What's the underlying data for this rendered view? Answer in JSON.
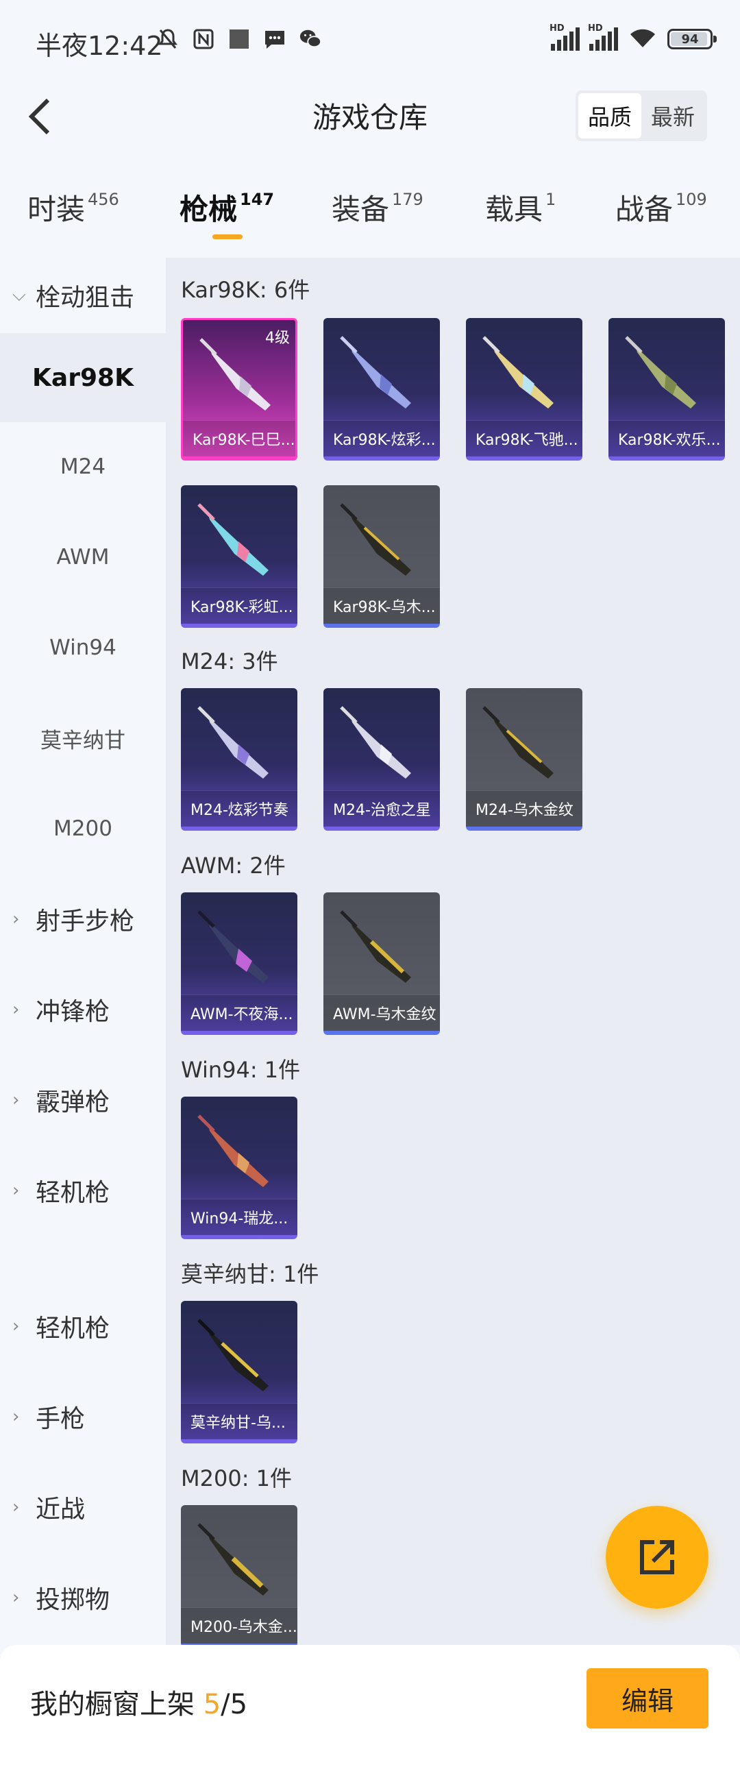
{
  "status_bar": {
    "time": "半夜12:42",
    "battery": "94",
    "hd1": "HD",
    "hd2": "HD"
  },
  "header": {
    "title": "游戏仓库",
    "sort_options": [
      "品质",
      "最新"
    ]
  },
  "tabs": [
    {
      "label": "时装",
      "count": "456"
    },
    {
      "label": "枪械",
      "count": "147"
    },
    {
      "label": "装备",
      "count": "179"
    },
    {
      "label": "载具",
      "count": "1"
    },
    {
      "label": "战备",
      "count": "109"
    }
  ],
  "sidebar": {
    "categories": [
      {
        "label": "栓动狙击",
        "arrow": "⌵"
      },
      {
        "label": "射手步枪",
        "arrow": "›"
      },
      {
        "label": "冲锋枪",
        "arrow": "›"
      },
      {
        "label": "霰弹枪",
        "arrow": "›"
      },
      {
        "label": "轻机枪",
        "arrow": "›"
      },
      {
        "label": "轻机枪",
        "arrow": "›"
      },
      {
        "label": "手枪",
        "arrow": "›"
      },
      {
        "label": "近战",
        "arrow": "›"
      },
      {
        "label": "投掷物",
        "arrow": "›"
      }
    ],
    "sub_items": [
      "Kar98K",
      "M24",
      "AWM",
      "Win94",
      "莫辛纳甘",
      "M200"
    ]
  },
  "sections": [
    {
      "title": "Kar98K: 6件",
      "items": [
        {
          "name": "Kar98K-巳巳...",
          "level": "4级"
        },
        {
          "name": "Kar98K-炫彩..."
        },
        {
          "name": "Kar98K-飞驰..."
        },
        {
          "name": "Kar98K-欢乐..."
        },
        {
          "name": "Kar98K-彩虹..."
        },
        {
          "name": "Kar98K-乌木..."
        }
      ]
    },
    {
      "title": "M24: 3件",
      "items": [
        {
          "name": "M24-炫彩节奏"
        },
        {
          "name": "M24-治愈之星"
        },
        {
          "name": "M24-乌木金纹"
        }
      ]
    },
    {
      "title": "AWM: 2件",
      "items": [
        {
          "name": "AWM-不夜海..."
        },
        {
          "name": "AWM-乌木金纹"
        }
      ]
    },
    {
      "title": "Win94: 1件",
      "items": [
        {
          "name": "Win94-瑞龙..."
        }
      ]
    },
    {
      "title": "莫辛纳甘: 1件",
      "items": [
        {
          "name": "莫辛纳甘-乌..."
        }
      ]
    },
    {
      "title": "M200: 1件",
      "items": [
        {
          "name": "M200-乌木金..."
        }
      ]
    }
  ],
  "bottom_bar": {
    "label": "我的橱窗上架",
    "current": "5",
    "separator": "/",
    "total": "5",
    "edit_label": "编辑"
  },
  "colors": {
    "accent": "#f5a623",
    "purple_rarity": "#7560e8",
    "pink_rarity": "#ff3fc8",
    "gray_rarity_bar": "#5d73ec"
  }
}
